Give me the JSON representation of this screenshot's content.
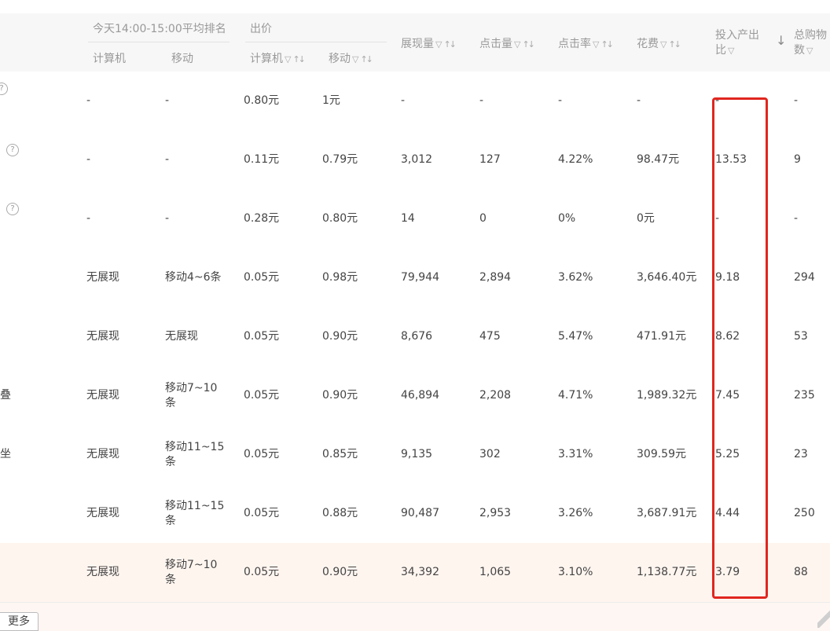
{
  "headers": {
    "rank_group": "今天14:00-15:00平均排名",
    "rank_pc": "计算机",
    "rank_mobile": "移动",
    "bid_group": "出价",
    "bid_pc": "计算机",
    "bid_mobile": "移动",
    "impressions": "展现量",
    "clicks": "点击量",
    "ctr": "点击率",
    "cost": "花费",
    "roi_line1": "投入产出",
    "roi_line2": "比",
    "carts_line1": "总购物",
    "carts_line2": "数",
    "sort_desc_arrow": "↓",
    "filter_icon": "▽",
    "sort_icon": "↑↓"
  },
  "rows": [
    {
      "rank_pc": "-",
      "rank_mobile": "-",
      "bid_pc": "0.80元",
      "bid_mobile": "1元",
      "impressions": "-",
      "clicks": "-",
      "ctr": "-",
      "cost": "-",
      "roi": "-",
      "carts": "-",
      "left_text": "",
      "help": true
    },
    {
      "rank_pc": "-",
      "rank_mobile": "-",
      "bid_pc": "0.11元",
      "bid_mobile": "0.79元",
      "impressions": "3,012",
      "clicks": "127",
      "ctr": "4.22%",
      "cost": "98.47元",
      "roi": "13.53",
      "carts": "9",
      "left_text": "",
      "help": true
    },
    {
      "rank_pc": "-",
      "rank_mobile": "-",
      "bid_pc": "0.28元",
      "bid_mobile": "0.80元",
      "impressions": "14",
      "clicks": "0",
      "ctr": "0%",
      "cost": "0元",
      "roi": "-",
      "carts": "-",
      "left_text": "",
      "help": true
    },
    {
      "rank_pc": "无展现",
      "rank_mobile": "移动4~6条",
      "bid_pc": "0.05元",
      "bid_mobile": "0.98元",
      "impressions": "79,944",
      "clicks": "2,894",
      "ctr": "3.62%",
      "cost": "3,646.40元",
      "roi": "9.18",
      "carts": "294",
      "left_text": "",
      "help": false
    },
    {
      "rank_pc": "无展现",
      "rank_mobile": "无展现",
      "bid_pc": "0.05元",
      "bid_mobile": "0.90元",
      "impressions": "8,676",
      "clicks": "475",
      "ctr": "5.47%",
      "cost": "471.91元",
      "roi": "8.62",
      "carts": "53",
      "left_text": "",
      "help": false
    },
    {
      "rank_pc": "无展现",
      "rank_mobile": "移动7~10条",
      "bid_pc": "0.05元",
      "bid_mobile": "0.90元",
      "impressions": "46,894",
      "clicks": "2,208",
      "ctr": "4.71%",
      "cost": "1,989.32元",
      "roi": "7.45",
      "carts": "235",
      "left_text": "叠",
      "help": false
    },
    {
      "rank_pc": "无展现",
      "rank_mobile": "移动11~15条",
      "bid_pc": "0.05元",
      "bid_mobile": "0.85元",
      "impressions": "9,135",
      "clicks": "302",
      "ctr": "3.31%",
      "cost": "309.59元",
      "roi": "5.25",
      "carts": "23",
      "left_text": "坐",
      "help": false
    },
    {
      "rank_pc": "无展现",
      "rank_mobile": "移动11~15条",
      "bid_pc": "0.05元",
      "bid_mobile": "0.88元",
      "impressions": "90,487",
      "clicks": "2,953",
      "ctr": "3.26%",
      "cost": "3,687.91元",
      "roi": "4.44",
      "carts": "250",
      "left_text": "",
      "help": false
    },
    {
      "rank_pc": "无展现",
      "rank_mobile": "移动7~10条",
      "bid_pc": "0.05元",
      "bid_mobile": "0.90元",
      "impressions": "34,392",
      "clicks": "1,065",
      "ctr": "3.10%",
      "cost": "1,138.77元",
      "roi": "3.79",
      "carts": "88",
      "left_text": "",
      "help": false
    }
  ],
  "footer": {
    "more_label": "更多"
  },
  "colors": {
    "highlight_box": "#e0261f",
    "selected_row_bg": "#fff5ef"
  }
}
